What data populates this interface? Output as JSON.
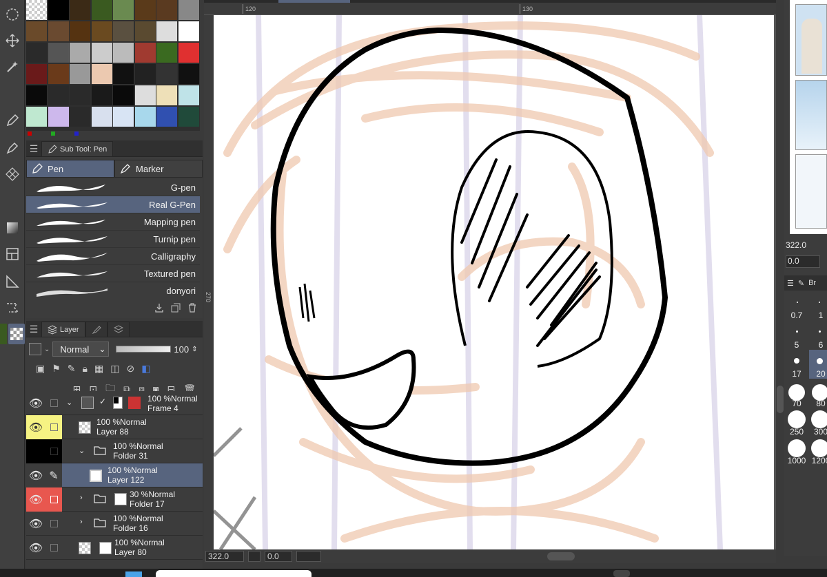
{
  "rulers": {
    "top_left": "120",
    "top_right": "130",
    "left": "270"
  },
  "palette": {
    "colors": [
      [
        "#3a3a3a",
        "#000000",
        "#3b2a16",
        "#3a5a20",
        "#6a8a50",
        "#5a3a1a",
        "#5a3a20",
        "#888888"
      ],
      [
        "#6a4a2a",
        "#6a4a30",
        "#553311",
        "#6a4a20",
        "#5a5040",
        "#5a4a30",
        "#dddddd",
        "#ffffff"
      ],
      [
        "#2a2a2a",
        "#555555",
        "#aaaaaa",
        "#cccccc",
        "#bbbbbb",
        "#a03a30",
        "#3a6a20",
        "#e03030"
      ],
      [
        "#6a1a1a",
        "#6a3a1a",
        "#999999",
        "#ecc9b0",
        "#111111",
        "#222222",
        "#333333",
        "#111111"
      ],
      [
        "#0a0a0a",
        "#2a2a2a",
        "#2a2a2a",
        "#1a1a1a",
        "#0a0a0a",
        "#dddddd",
        "#eee0b8",
        "#bfe3e8"
      ],
      [
        "#bfe8d0",
        "#cdb8ec",
        "#2a2a2a",
        "#d8e0ee",
        "#d8e4f4",
        "#a8d8ec",
        "#3050b0",
        "#204a3a"
      ]
    ]
  },
  "subtool": {
    "panel_title": "Sub Tool: Pen",
    "groups": [
      {
        "label": "Pen"
      },
      {
        "label": "Marker"
      }
    ],
    "brushes": [
      {
        "label": "G-pen"
      },
      {
        "label": "Real G-Pen"
      },
      {
        "label": "Mapping pen"
      },
      {
        "label": "Turnip pen"
      },
      {
        "label": "Calligraphy"
      },
      {
        "label": "Textured pen"
      },
      {
        "label": "donyori"
      }
    ]
  },
  "layer_panel": {
    "tab": "Layer",
    "blend_mode": "Normal",
    "opacity": "100",
    "layers": [
      {
        "mode": "100 %Normal",
        "name": "Frame 4",
        "color": ""
      },
      {
        "mode": "100 %Normal",
        "name": "Layer 88",
        "color": "#f6f383"
      },
      {
        "mode": "100 %Normal",
        "name": "Folder 31",
        "color": "#000000"
      },
      {
        "mode": "100 %Normal",
        "name": "Layer 122",
        "color": "",
        "selected": true
      },
      {
        "mode": "30 %Normal",
        "name": "Folder 17",
        "color": "#e8574f"
      },
      {
        "mode": "100 %Normal",
        "name": "Folder 16",
        "color": ""
      },
      {
        "mode": "100 %Normal",
        "name": "Layer 80",
        "color": ""
      }
    ]
  },
  "status": {
    "zoom": "322.0",
    "angle": "0.0"
  },
  "right_panel": {
    "zoom": "322.0",
    "angle": "0.0",
    "brush_tab": "Br",
    "brush_sizes": [
      "0.7",
      "1",
      "5",
      "6",
      "17",
      "20",
      "70",
      "80",
      "250",
      "300",
      "1000",
      "1200"
    ]
  }
}
